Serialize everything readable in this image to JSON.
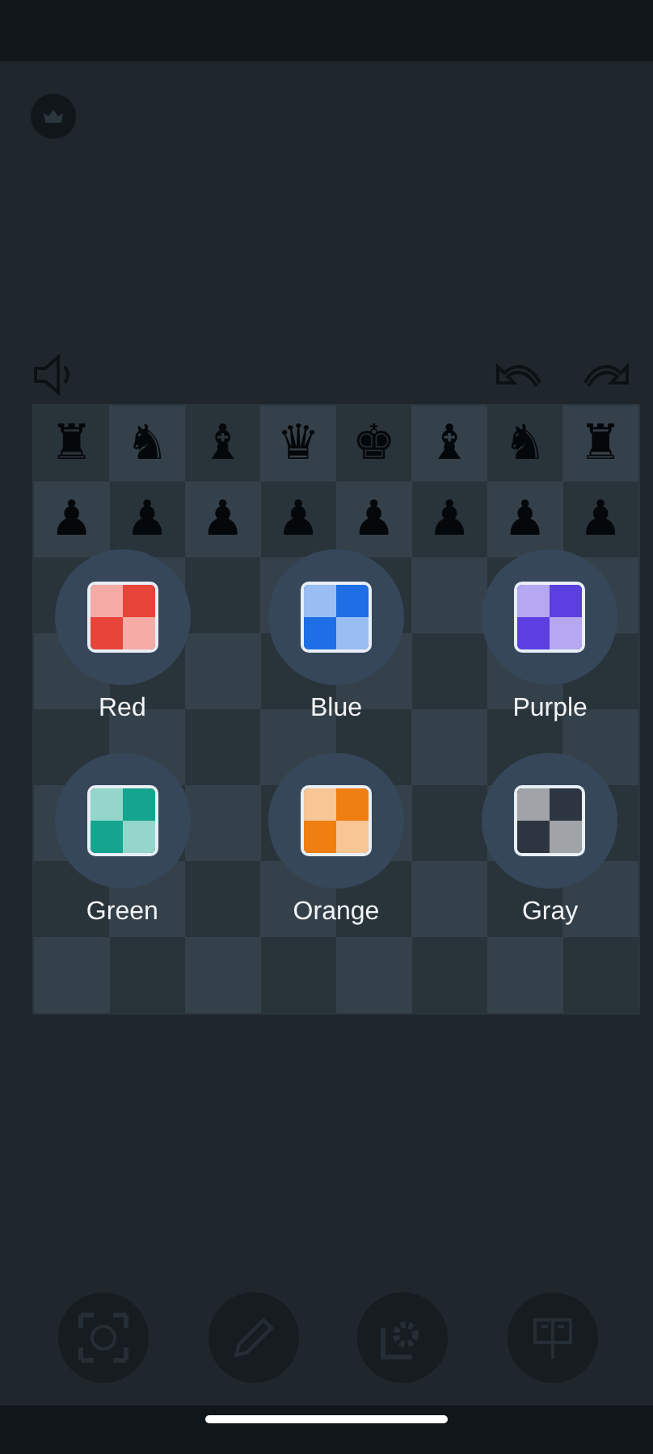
{
  "board": {
    "rows": [
      [
        "♜",
        "♞",
        "♝",
        "♛",
        "♚",
        "♝",
        "♞",
        "♜"
      ],
      [
        "♟",
        "♟",
        "♟",
        "♟",
        "♟",
        "♟",
        "♟",
        "♟"
      ]
    ]
  },
  "theme_options": [
    {
      "label": "Red",
      "color": "#e8453a"
    },
    {
      "label": "Blue",
      "color": "#1e6fe6"
    },
    {
      "label": "Purple",
      "color": "#5b3fe0"
    },
    {
      "label": "Green",
      "color": "#14a58e"
    },
    {
      "label": "Orange",
      "color": "#f07f12"
    },
    {
      "label": "Gray",
      "color": "#2d3640"
    }
  ]
}
